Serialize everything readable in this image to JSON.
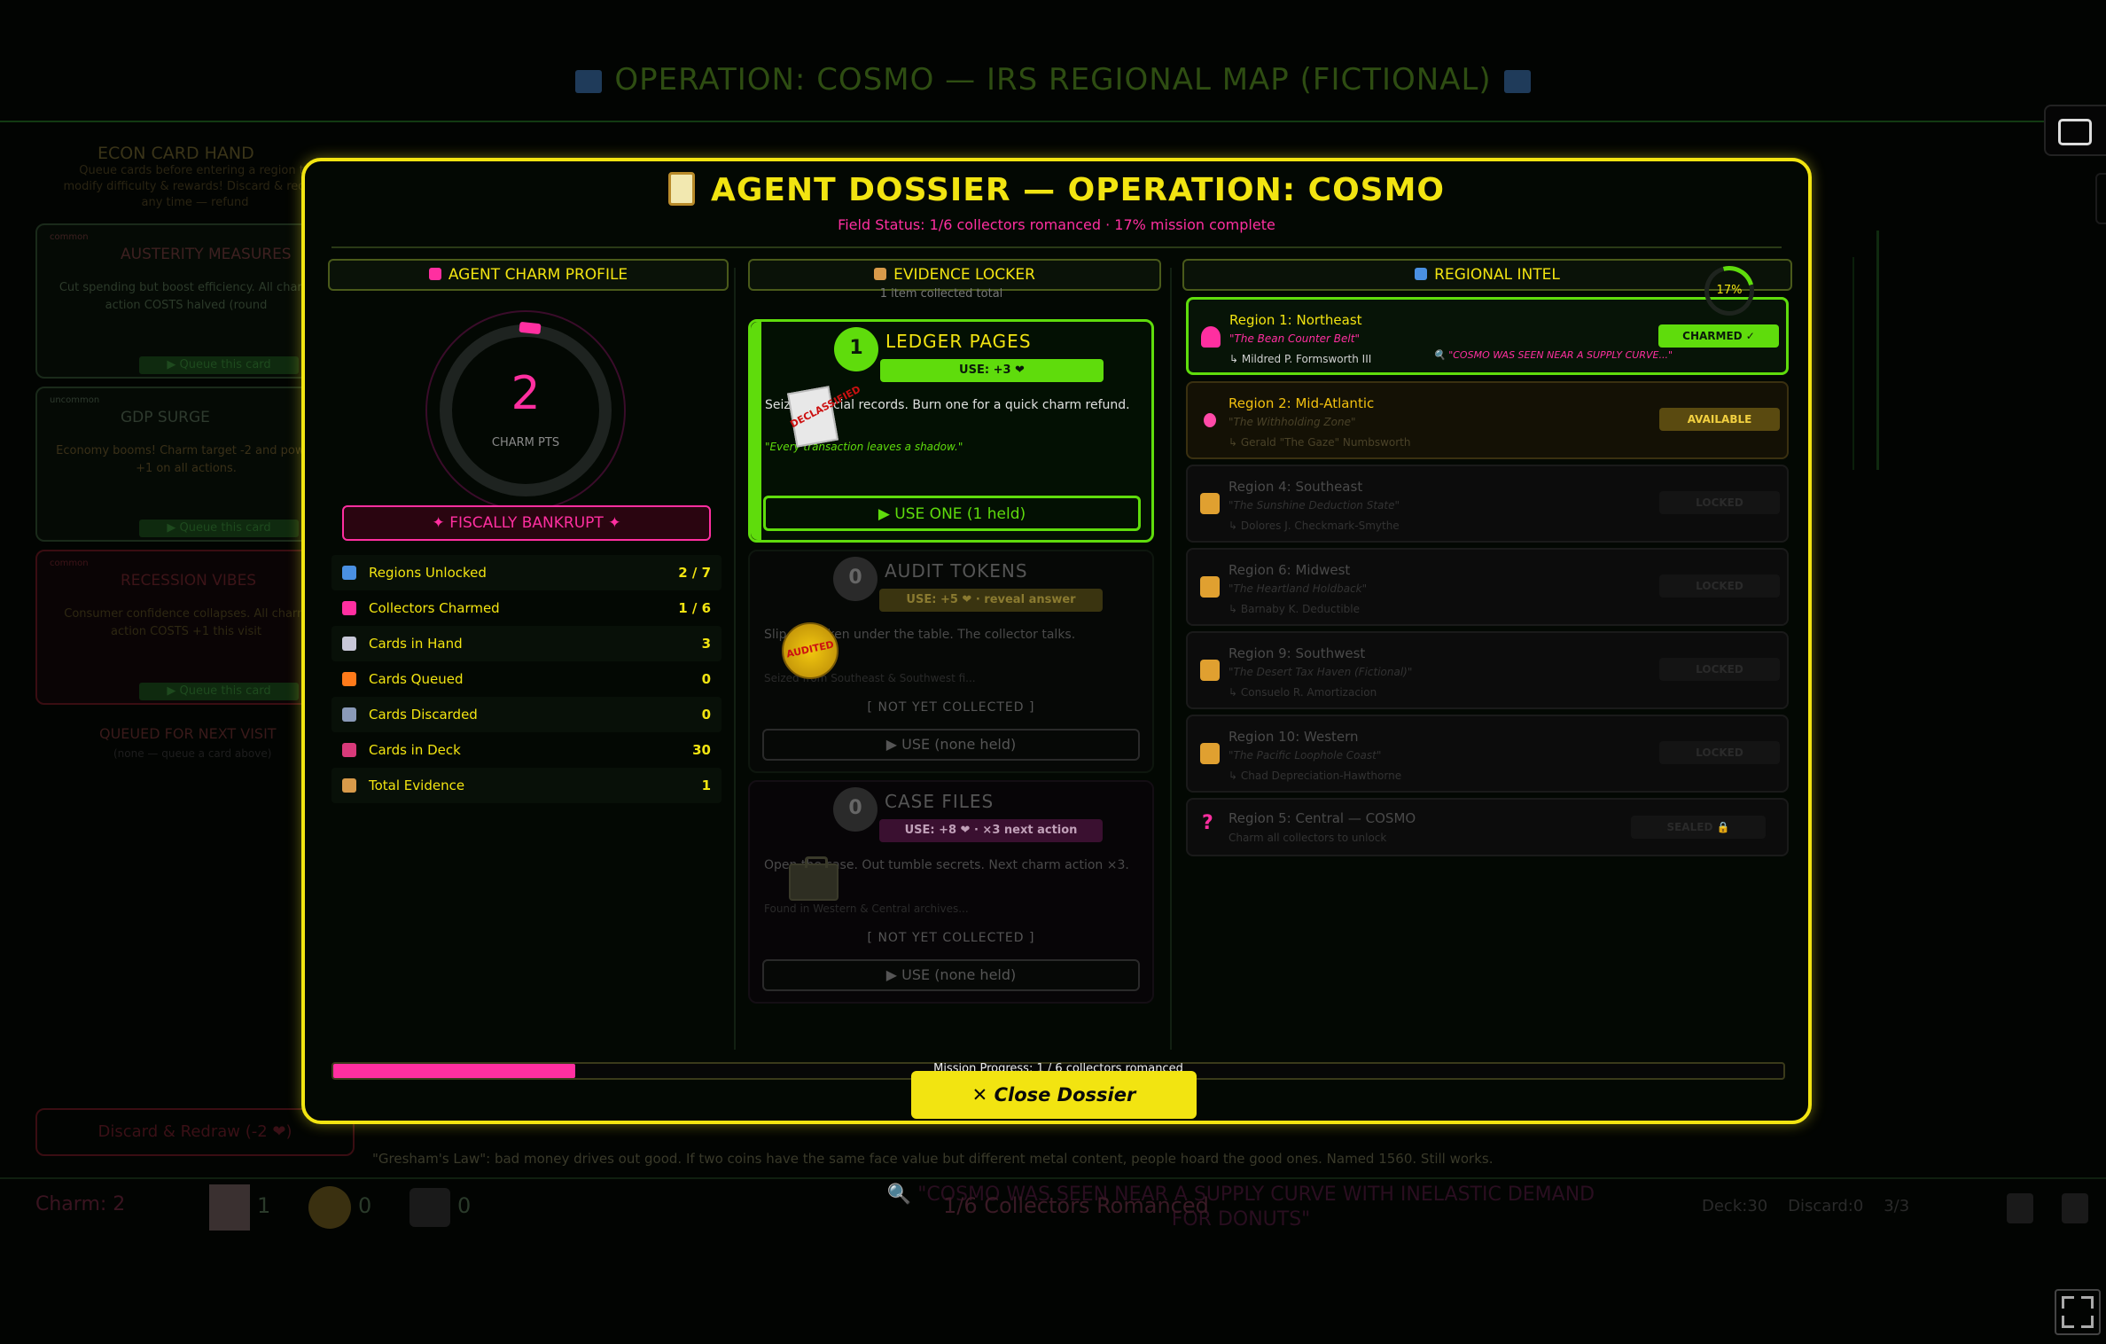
{
  "background": {
    "title": "OPERATION: COSMO — IRS REGIONAL MAP (FICTIONAL)",
    "hand": {
      "title": "ECON CARD HAND",
      "subtitle": "Queue cards before entering a region to modify difficulty & rewards! Discard & redraw any time — refund",
      "cards": [
        {
          "tier": "common",
          "title": "AUSTERITY MEASURES",
          "desc": "Cut spending but boost efficiency. All charm action COSTS halved (round",
          "queue": "▶ Queue this card"
        },
        {
          "tier": "uncommon",
          "title": "GDP SURGE",
          "desc": "Economy booms! Charm target -2 and power +1 on all actions.",
          "queue": "▶ Queue this card"
        },
        {
          "tier": "common",
          "title": "RECESSION VIBES",
          "desc": "Consumer confidence collapses. All charm action COSTS +1 this visit",
          "queue": "▶ Queue this card"
        }
      ],
      "queued_title": "QUEUED FOR NEXT VISIT",
      "queued_sub": "(none — queue a card above)",
      "discard_button": "Discard & Redraw (-2 ❤)"
    },
    "tip": "\"Gresham's Law\": bad money drives out good. If two coins have the same face value but different metal content, people hoard the good ones. Named 1560. Still works.",
    "footer": {
      "charm": "Charm: 2",
      "ledger": "1",
      "audit": "0",
      "case": "0",
      "romanced": "1/6 Collectors Romanced",
      "sighting": "🔍 \"COSMO WAS SEEN NEAR A SUPPLY CURVE WITH INELASTIC DEMAND FOR DONUTS\"",
      "deck": "Deck:30",
      "discard": "Discard:0",
      "redraw": "3/3"
    }
  },
  "dossier": {
    "title": "AGENT DOSSIER — OPERATION: COSMO",
    "status": "Field Status: 1/6 collectors romanced · 17% mission complete",
    "charm_profile": {
      "header": "AGENT CHARM PROFILE",
      "charm_value": "2",
      "charm_label": "CHARM PTS",
      "rank": "✦ FISCALLY BANKRUPT ✦",
      "stats": [
        {
          "label": "Regions Unlocked",
          "value": "2 / 7",
          "color": "#4a90e2"
        },
        {
          "label": "Collectors Charmed",
          "value": "1 / 6",
          "color": "#ff2fa0"
        },
        {
          "label": "Cards in Hand",
          "value": "3",
          "color": "#c8c8d8"
        },
        {
          "label": "Cards Queued",
          "value": "0",
          "color": "#ff7a1a"
        },
        {
          "label": "Cards Discarded",
          "value": "0",
          "color": "#8a9ab8"
        },
        {
          "label": "Cards in Deck",
          "value": "30",
          "color": "#d83a7a"
        },
        {
          "label": "Total Evidence",
          "value": "1",
          "color": "#d89a4a"
        }
      ]
    },
    "evidence": {
      "header": "EVIDENCE LOCKER",
      "sub": "1 item collected total",
      "items": [
        {
          "count": "1",
          "name": "LEDGER PAGES",
          "use": "USE: +3 ❤",
          "desc": "Seize financial records. Burn one for a quick charm refund.",
          "quote": "\"Every transaction leaves a shadow.\"",
          "stamp": "DECLASSIFIED",
          "button": "▶ USE ONE  (1 held)"
        },
        {
          "count": "0",
          "name": "AUDIT TOKENS",
          "use": "USE: +5 ❤ · reveal answer",
          "desc": "Slip the token under the table. The collector talks.",
          "sub": "Seized from Southeast & Southwest fi...",
          "stamp": "AUDITED",
          "notyet": "[ NOT YET COLLECTED ]",
          "button": "▶ USE  (none held)"
        },
        {
          "count": "0",
          "name": "CASE FILES",
          "use": "USE: +8 ❤ · ×3 next action",
          "desc": "Open the case. Out tumble secrets. Next charm action ×3.",
          "sub": "Found in Western & Central archives...",
          "notyet": "[ NOT YET COLLECTED ]",
          "button": "▶ USE  (none held)"
        }
      ]
    },
    "intel": {
      "header": "REGIONAL INTEL",
      "percent": "17%",
      "regions": [
        {
          "name": "Region 1: Northeast",
          "nick": "\"The Bean Counter Belt\"",
          "agent": "↳ Mildred P. Formsworth III",
          "status": "CHARMED ✓",
          "note": "🔍 \"COSMO WAS SEEN NEAR A SUPPLY CURVE...\""
        },
        {
          "name": "Region 2: Mid-Atlantic",
          "nick": "\"The Withholding Zone\"",
          "agent": "↳ Gerald \"The Gaze\" Numbsworth",
          "status": "AVAILABLE"
        },
        {
          "name": "Region 4: Southeast",
          "nick": "\"The Sunshine Deduction State\"",
          "agent": "↳ Dolores J. Checkmark-Smythe",
          "status": "LOCKED"
        },
        {
          "name": "Region 6: Midwest",
          "nick": "\"The Heartland Holdback\"",
          "agent": "↳ Barnaby K. Deductible",
          "status": "LOCKED"
        },
        {
          "name": "Region 9: Southwest",
          "nick": "\"The Desert Tax Haven (Fictional)\"",
          "agent": "↳ Consuelo R. Amortizacion",
          "status": "LOCKED"
        },
        {
          "name": "Region 10: Western",
          "nick": "\"The Pacific Loophole Coast\"",
          "agent": "↳ Chad Depreciation-Hawthorne",
          "status": "LOCKED"
        },
        {
          "name": "Region 5: Central — COSMO",
          "nick": "Charm all collectors to unlock",
          "status": "SEALED 🔒"
        }
      ]
    },
    "progress": {
      "label": "Mission Progress: 1 / 6 collectors romanced",
      "fraction": 0.167
    },
    "close_button": "✕  Close Dossier"
  }
}
